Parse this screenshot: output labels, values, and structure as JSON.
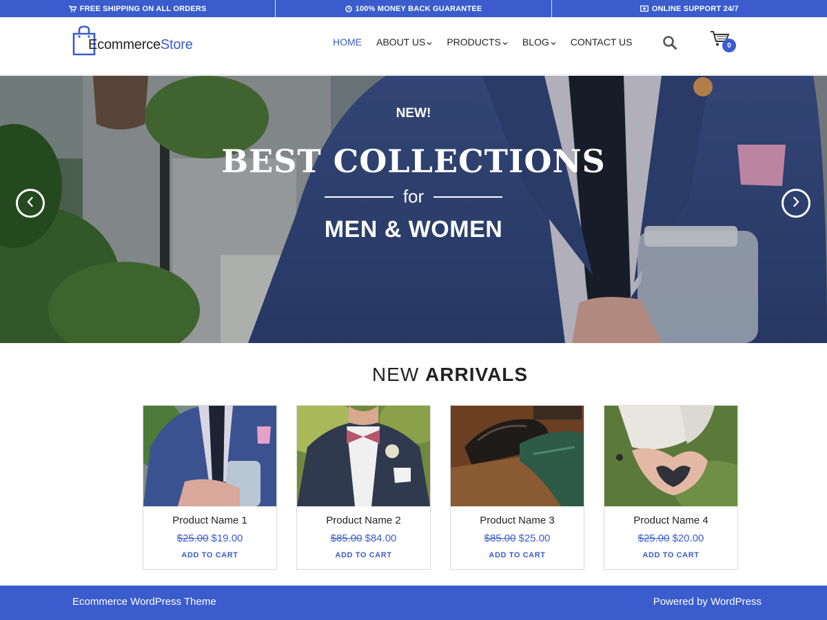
{
  "topbar": {
    "shipping": {
      "icon": "cart-icon",
      "label": "FREE SHIPPING ON ALL ORDERS"
    },
    "guarantee": {
      "icon": "clock-icon",
      "label": "100% MONEY BACK GUARANTEE"
    },
    "support": {
      "icon": "money-icon",
      "label": "ONLINE SUPPORT 24/7"
    }
  },
  "header": {
    "logo": {
      "part1": "Ecommerce",
      "part2": "Store",
      "icon": "shopping-bag-icon"
    },
    "nav": [
      {
        "label": "HOME",
        "active": true,
        "dropdown": false
      },
      {
        "label": "ABOUT US",
        "active": false,
        "dropdown": true
      },
      {
        "label": "PRODUCTS",
        "active": false,
        "dropdown": true
      },
      {
        "label": "BLOG",
        "active": false,
        "dropdown": true
      },
      {
        "label": "CONTACT US",
        "active": false,
        "dropdown": false
      }
    ],
    "search_icon": "search-icon",
    "cart": {
      "icon": "cart-icon",
      "count": "0"
    }
  },
  "hero": {
    "tag": "NEW!",
    "title": "BEST COLLECTIONS",
    "connector": "for",
    "subtitle": "MEN & WOMEN",
    "prev_icon": "chevron-left-icon",
    "next_icon": "chevron-right-icon"
  },
  "arrivals": {
    "title_light": "NEW",
    "title_bold": "ARRIVALS",
    "products": [
      {
        "name": "Product Name 1",
        "old_price": "$25.00",
        "price": "$19.00",
        "cta": "ADD TO CART"
      },
      {
        "name": "Product Name 2",
        "old_price": "$85.00",
        "price": "$84.00",
        "cta": "ADD TO CART"
      },
      {
        "name": "Product Name 3",
        "old_price": "$85.00",
        "price": "$25.00",
        "cta": "ADD TO CART"
      },
      {
        "name": "Product Name 4",
        "old_price": "$25.00",
        "price": "$20.00",
        "cta": "ADD TO CART"
      }
    ]
  },
  "footer": {
    "left": "Ecommerce WordPress Theme",
    "right": "Powered by WordPress"
  },
  "colors": {
    "accent": "#3a5ccc",
    "text": "#222222"
  }
}
